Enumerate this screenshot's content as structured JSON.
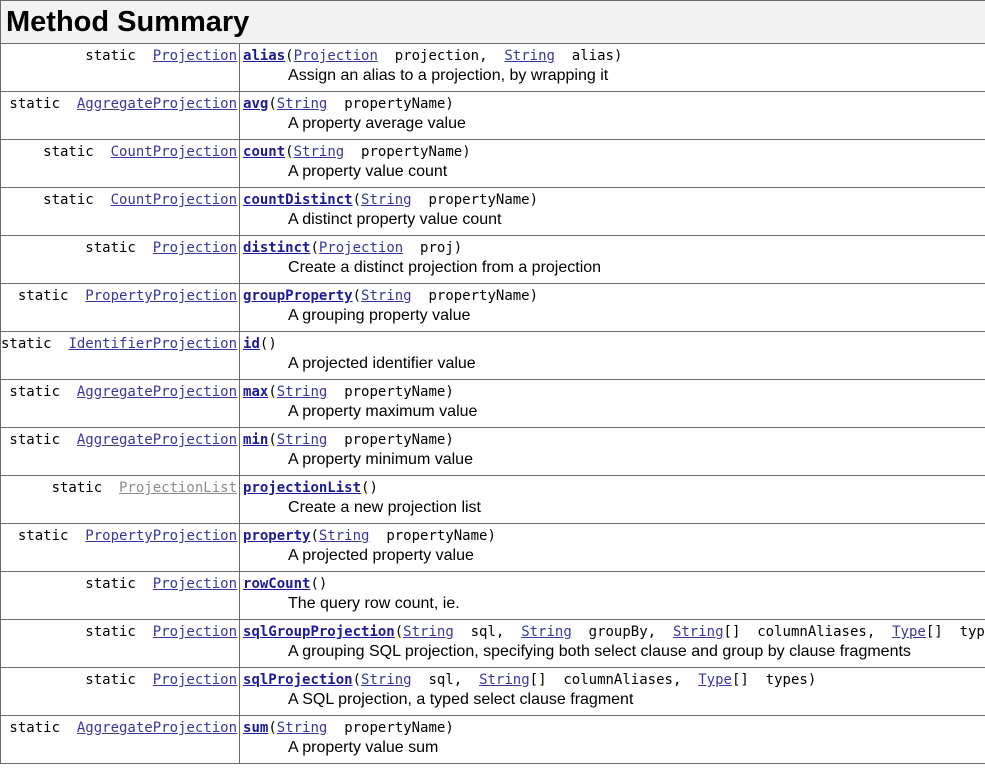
{
  "heading": "Method Summary",
  "rows": [
    {
      "modifier": "static",
      "return_type": "Projection",
      "return_type_visited": false,
      "method": "alias",
      "params": [
        {
          "type": "Projection",
          "name": "projection"
        },
        {
          "type": "String",
          "name": "alias"
        }
      ],
      "description": "Assign an alias to a projection, by wrapping it"
    },
    {
      "modifier": "static",
      "return_type": "AggregateProjection",
      "return_type_visited": false,
      "method": "avg",
      "params": [
        {
          "type": "String",
          "name": "propertyName"
        }
      ],
      "description": "A property average value"
    },
    {
      "modifier": "static",
      "return_type": "CountProjection",
      "return_type_visited": false,
      "method": "count",
      "params": [
        {
          "type": "String",
          "name": "propertyName"
        }
      ],
      "description": "A property value count"
    },
    {
      "modifier": "static",
      "return_type": "CountProjection",
      "return_type_visited": false,
      "method": "countDistinct",
      "params": [
        {
          "type": "String",
          "name": "propertyName"
        }
      ],
      "description": "A distinct property value count"
    },
    {
      "modifier": "static",
      "return_type": "Projection",
      "return_type_visited": false,
      "method": "distinct",
      "params": [
        {
          "type": "Projection",
          "name": "proj"
        }
      ],
      "description": "Create a distinct projection from a projection"
    },
    {
      "modifier": "static",
      "return_type": "PropertyProjection",
      "return_type_visited": false,
      "method": "groupProperty",
      "params": [
        {
          "type": "String",
          "name": "propertyName"
        }
      ],
      "description": "A grouping property value"
    },
    {
      "modifier": "static",
      "return_type": "IdentifierProjection",
      "return_type_visited": false,
      "method": "id",
      "params": [],
      "description": "A projected identifier value"
    },
    {
      "modifier": "static",
      "return_type": "AggregateProjection",
      "return_type_visited": false,
      "method": "max",
      "params": [
        {
          "type": "String",
          "name": "propertyName"
        }
      ],
      "description": "A property maximum value"
    },
    {
      "modifier": "static",
      "return_type": "AggregateProjection",
      "return_type_visited": false,
      "method": "min",
      "params": [
        {
          "type": "String",
          "name": "propertyName"
        }
      ],
      "description": "A property minimum value"
    },
    {
      "modifier": "static",
      "return_type": "ProjectionList",
      "return_type_visited": true,
      "method": "projectionList",
      "params": [],
      "description": "Create a new projection list"
    },
    {
      "modifier": "static",
      "return_type": "PropertyProjection",
      "return_type_visited": false,
      "method": "property",
      "params": [
        {
          "type": "String",
          "name": "propertyName"
        }
      ],
      "description": "A projected property value"
    },
    {
      "modifier": "static",
      "return_type": "Projection",
      "return_type_visited": false,
      "method": "rowCount",
      "params": [],
      "description": "The query row count, ie."
    },
    {
      "modifier": "static",
      "return_type": "Projection",
      "return_type_visited": false,
      "method": "sqlGroupProjection",
      "params": [
        {
          "type": "String",
          "name": "sql"
        },
        {
          "type": "String",
          "name": "groupBy"
        },
        {
          "type": "String",
          "array": "[]",
          "name": "columnAliases"
        },
        {
          "type": "Type",
          "array": "[]",
          "name": "types"
        }
      ],
      "description": "A grouping SQL projection, specifying both select clause and group by clause fragments"
    },
    {
      "modifier": "static",
      "return_type": "Projection",
      "return_type_visited": false,
      "method": "sqlProjection",
      "params": [
        {
          "type": "String",
          "name": "sql"
        },
        {
          "type": "String",
          "array": "[]",
          "name": "columnAliases"
        },
        {
          "type": "Type",
          "array": "[]",
          "name": "types"
        }
      ],
      "description": "A SQL projection, a typed select clause fragment"
    },
    {
      "modifier": "static",
      "return_type": "AggregateProjection",
      "return_type_visited": false,
      "method": "sum",
      "params": [
        {
          "type": "String",
          "name": "propertyName"
        }
      ],
      "description": "A property value sum"
    }
  ],
  "colors": {
    "link": "#38389c",
    "method_link": "#1a1a9a",
    "visited_link": "#8c8c8c",
    "heading_background": "#f2f2f2",
    "border": "#6b6b6b"
  }
}
